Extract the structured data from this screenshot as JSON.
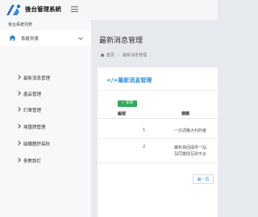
{
  "header": {
    "brand": "後台管理系統",
    "logo": "logo-icon",
    "menu_icon": "hamburger-icon"
  },
  "sidebar": {
    "title": "後台系統列表",
    "group": {
      "label": "系統列表",
      "icon": "home-icon",
      "caret": "chevron-down-icon"
    },
    "items": [
      {
        "label": "最新消息管理"
      },
      {
        "label": "產品管理"
      },
      {
        "label": "訂單管理"
      },
      {
        "label": "場匯牌管理"
      },
      {
        "label": "磁鐵體肝搞秋"
      },
      {
        "label": "參數設訂"
      }
    ]
  },
  "main": {
    "title": "最新消息管理",
    "breadcrumb": {
      "home": "首頁",
      "current": "最新消息管理"
    },
    "card_title": "最新消息管理",
    "add_label": "新增",
    "table": {
      "headers": {
        "id": "編號",
        "title": "標題"
      },
      "rows": [
        {
          "id": "1",
          "title_lines": [
            "一次詞義大利的番"
          ]
        },
        {
          "id": "2",
          "title_lines": [
            "擴秋為回提供一站",
            "及同業間互助平台"
          ]
        }
      ]
    },
    "next_label": "第一頁"
  },
  "colors": {
    "accent": "#2e8fd6",
    "add_button": "#2eaa5a",
    "background": "#e6e9ee"
  }
}
